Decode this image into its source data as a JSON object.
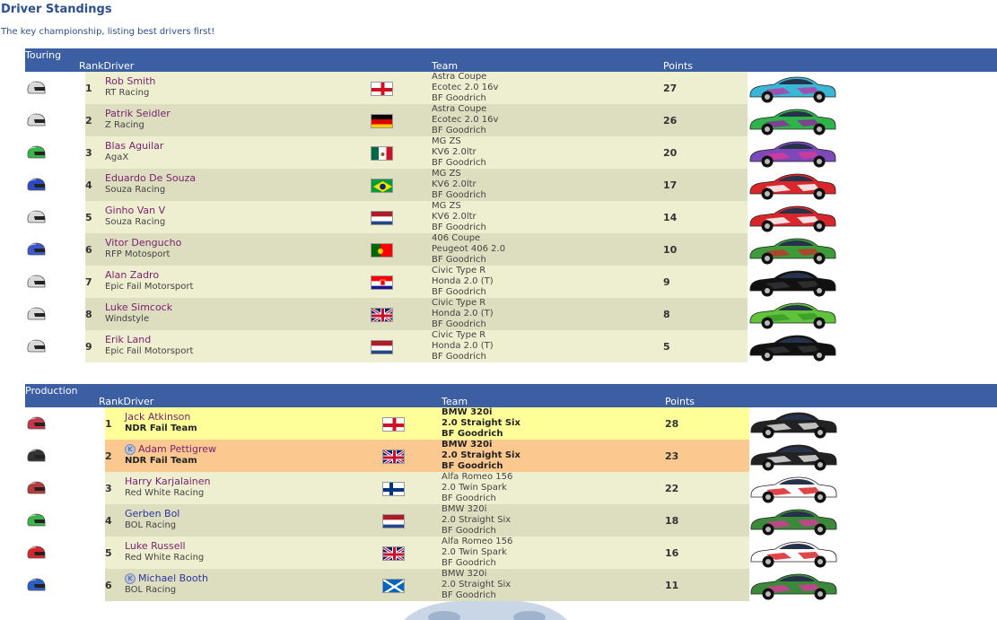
{
  "page": {
    "title": "Driver Standings",
    "subtitle": "The key championship, listing best drivers first!"
  },
  "colors": {
    "header_bg": "#3b5fa2",
    "row_odd": "#eeeed0",
    "row_even": "#ddddc0",
    "gold": "#ffff99",
    "silver": "#fbc88f",
    "name": "#7a1f6e",
    "name_blue": "#2c35a0"
  },
  "touring": {
    "title": "Touring",
    "headers": {
      "rank_driver": "RankDriver",
      "team": "Team",
      "points": "Points"
    },
    "rows": [
      {
        "rank": "1",
        "name": "Rob Smith",
        "team": "RT Racing",
        "flag": "eng",
        "car1": "Astra Coupe",
        "car2": "Ecotec 2.0 16v",
        "car3": "BF Goodrich",
        "points": "27",
        "helmet": "#d9d9d9",
        "c1": "#3ab6d6",
        "c2": "#b03fa8"
      },
      {
        "rank": "2",
        "name": "Patrik Seidler",
        "team": "Z Racing",
        "flag": "de",
        "car1": "Astra Coupe",
        "car2": "Ecotec 2.0 16v",
        "car3": "BF Goodrich",
        "points": "26",
        "helmet": "#d9d9d9",
        "c1": "#2fb44a",
        "c2": "#8a2f9a"
      },
      {
        "rank": "3",
        "name": "Blas Aguilar",
        "team": "AgaX",
        "flag": "mx",
        "car1": "MG ZS",
        "car2": "KV6 2.0ltr",
        "car3": "BF Goodrich",
        "points": "20",
        "helmet": "#3bb54a",
        "c1": "#7d49b8",
        "c2": "#d63a9a"
      },
      {
        "rank": "4",
        "name": "Eduardo De Souza",
        "team": "Souza Racing",
        "flag": "br",
        "car1": "MG ZS",
        "car2": "KV6 2.0ltr",
        "car3": "BF Goodrich",
        "points": "17",
        "helmet": "#2b4ac4",
        "c1": "#d8262a",
        "c2": "#ffffff"
      },
      {
        "rank": "5",
        "name": "Ginho Van V",
        "team": "Souza Racing",
        "flag": "nl",
        "car1": "MG ZS",
        "car2": "KV6 2.0ltr",
        "car3": "BF Goodrich",
        "points": "14",
        "helmet": "#d9d9d9",
        "c1": "#d8262a",
        "c2": "#ffffff"
      },
      {
        "rank": "6",
        "name": "Vitor Dengucho",
        "team": "RFP Motosport",
        "flag": "pt",
        "car1": "406 Coupe",
        "car2": "Peugeot 406 2.0",
        "car3": "BF Goodrich",
        "points": "10",
        "helmet": "#3b57c9",
        "c1": "#3d9b3a",
        "c2": "#b83a2a"
      },
      {
        "rank": "7",
        "name": "Alan Zadro",
        "team": "Epic Fail Motorsport",
        "flag": "hr",
        "car1": "Civic Type R",
        "car2": "Honda 2.0 (T)",
        "car3": "BF Goodrich",
        "points": "9",
        "helmet": "#d9d9d9",
        "c1": "#111111",
        "c2": "#333333"
      },
      {
        "rank": "8",
        "name": "Luke Simcock",
        "team": "Windstyle",
        "flag": "gb",
        "car1": "Civic Type R",
        "car2": "Honda 2.0 (T)",
        "car3": "BF Goodrich",
        "points": "8",
        "helmet": "#d9d9d9",
        "c1": "#5fc43a",
        "c2": "#3a9a2a"
      },
      {
        "rank": "9",
        "name": "Erik Land",
        "team": "Epic Fail Motorsport",
        "flag": "nl",
        "car1": "Civic Type R",
        "car2": "Honda 2.0 (T)",
        "car3": "BF Goodrich",
        "points": "5",
        "helmet": "#d9d9d9",
        "c1": "#111111",
        "c2": "#333333"
      }
    ]
  },
  "production": {
    "title": "Production",
    "headers": {
      "rank_driver": "RankDriver",
      "team": "Team",
      "points": "Points"
    },
    "rows": [
      {
        "rank": "1",
        "name": "Jack Atkinson",
        "team": "NDR Fail Team",
        "flag": "eng",
        "car1": "BMW 320i",
        "car2": "2.0 Straight Six",
        "car3": "BF Goodrich",
        "points": "28",
        "helmet": "#c9364a",
        "c1": "#222222",
        "c2": "#dddddd",
        "bold": true,
        "bg": "gold"
      },
      {
        "rank": "2",
        "name": "Adam Pettigrew",
        "team": "NDR Fail Team",
        "flag": "gb",
        "car1": "BMW 320i",
        "car2": "2.0 Straight Six",
        "car3": "BF Goodrich",
        "points": "23",
        "helmet": "#333333",
        "c1": "#222222",
        "c2": "#dddddd",
        "bold": true,
        "bg": "silver",
        "kicon": true
      },
      {
        "rank": "3",
        "name": "Harry Karjalainen",
        "team": "Red White Racing",
        "flag": "fi",
        "car1": "Alfa Romeo 156",
        "car2": "2.0 Twin Spark",
        "car3": "BF Goodrich",
        "points": "22",
        "helmet": "#b93a3a",
        "c1": "#ffffff",
        "c2": "#d8262a"
      },
      {
        "rank": "4",
        "name": "Gerben Bol",
        "team": "BOL Racing",
        "flag": "nl",
        "car1": "BMW 320i",
        "car2": "2.0 Straight Six",
        "car3": "BF Goodrich",
        "points": "18",
        "helmet": "#3bb54a",
        "c1": "#3a8a3a",
        "c2": "#d63a9a",
        "blue": true
      },
      {
        "rank": "5",
        "name": "Luke Russell",
        "team": "Red White Racing",
        "flag": "gb",
        "car1": "Alfa Romeo 156",
        "car2": "2.0 Twin Spark",
        "car3": "BF Goodrich",
        "points": "16",
        "helmet": "#d8262a",
        "c1": "#ffffff",
        "c2": "#d8262a"
      },
      {
        "rank": "6",
        "name": "Michael Booth",
        "team": "BOL Racing",
        "flag": "sc",
        "car1": "BMW 320i",
        "car2": "2.0 Straight Six",
        "car3": "BF Goodrich",
        "points": "11",
        "helmet": "#2b5fc4",
        "c1": "#3a8a3a",
        "c2": "#d63a9a",
        "kicon": true,
        "blue": true
      }
    ]
  }
}
